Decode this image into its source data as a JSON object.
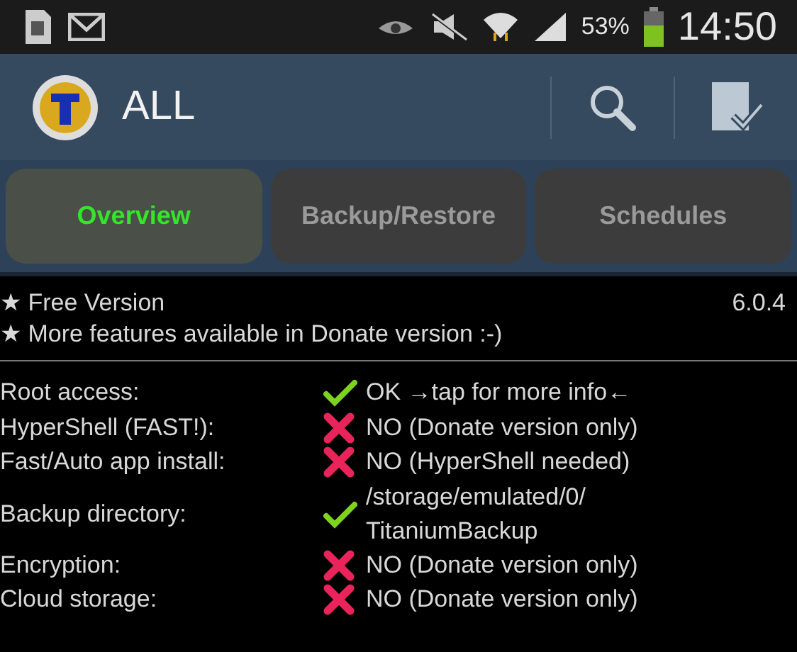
{
  "status_bar": {
    "battery_percent": "53%",
    "time": "14:50"
  },
  "action_bar": {
    "title": "ALL"
  },
  "tabs": [
    {
      "label": "Overview",
      "selected": true
    },
    {
      "label": "Backup/Restore",
      "selected": false
    },
    {
      "label": "Schedules",
      "selected": false
    }
  ],
  "info": {
    "lines": [
      "★ Free Version",
      "★ More features available in Donate version :-)"
    ],
    "version": "6.0.4"
  },
  "checks": [
    {
      "label": "Root access:",
      "ok": true,
      "value": "OK →tap for more info←"
    },
    {
      "label": "HyperShell (FAST!):",
      "ok": false,
      "value": "NO (Donate version only)"
    },
    {
      "label": "Fast/Auto app install:",
      "ok": false,
      "value": "NO (HyperShell needed)"
    },
    {
      "label": "Backup directory:",
      "ok": true,
      "value": "/storage/emulated/0/\nTitaniumBackup"
    },
    {
      "label": "Encryption:",
      "ok": false,
      "value": "NO (Donate version only)"
    },
    {
      "label": "Cloud storage:",
      "ok": false,
      "value": "NO (Donate version only)"
    }
  ]
}
